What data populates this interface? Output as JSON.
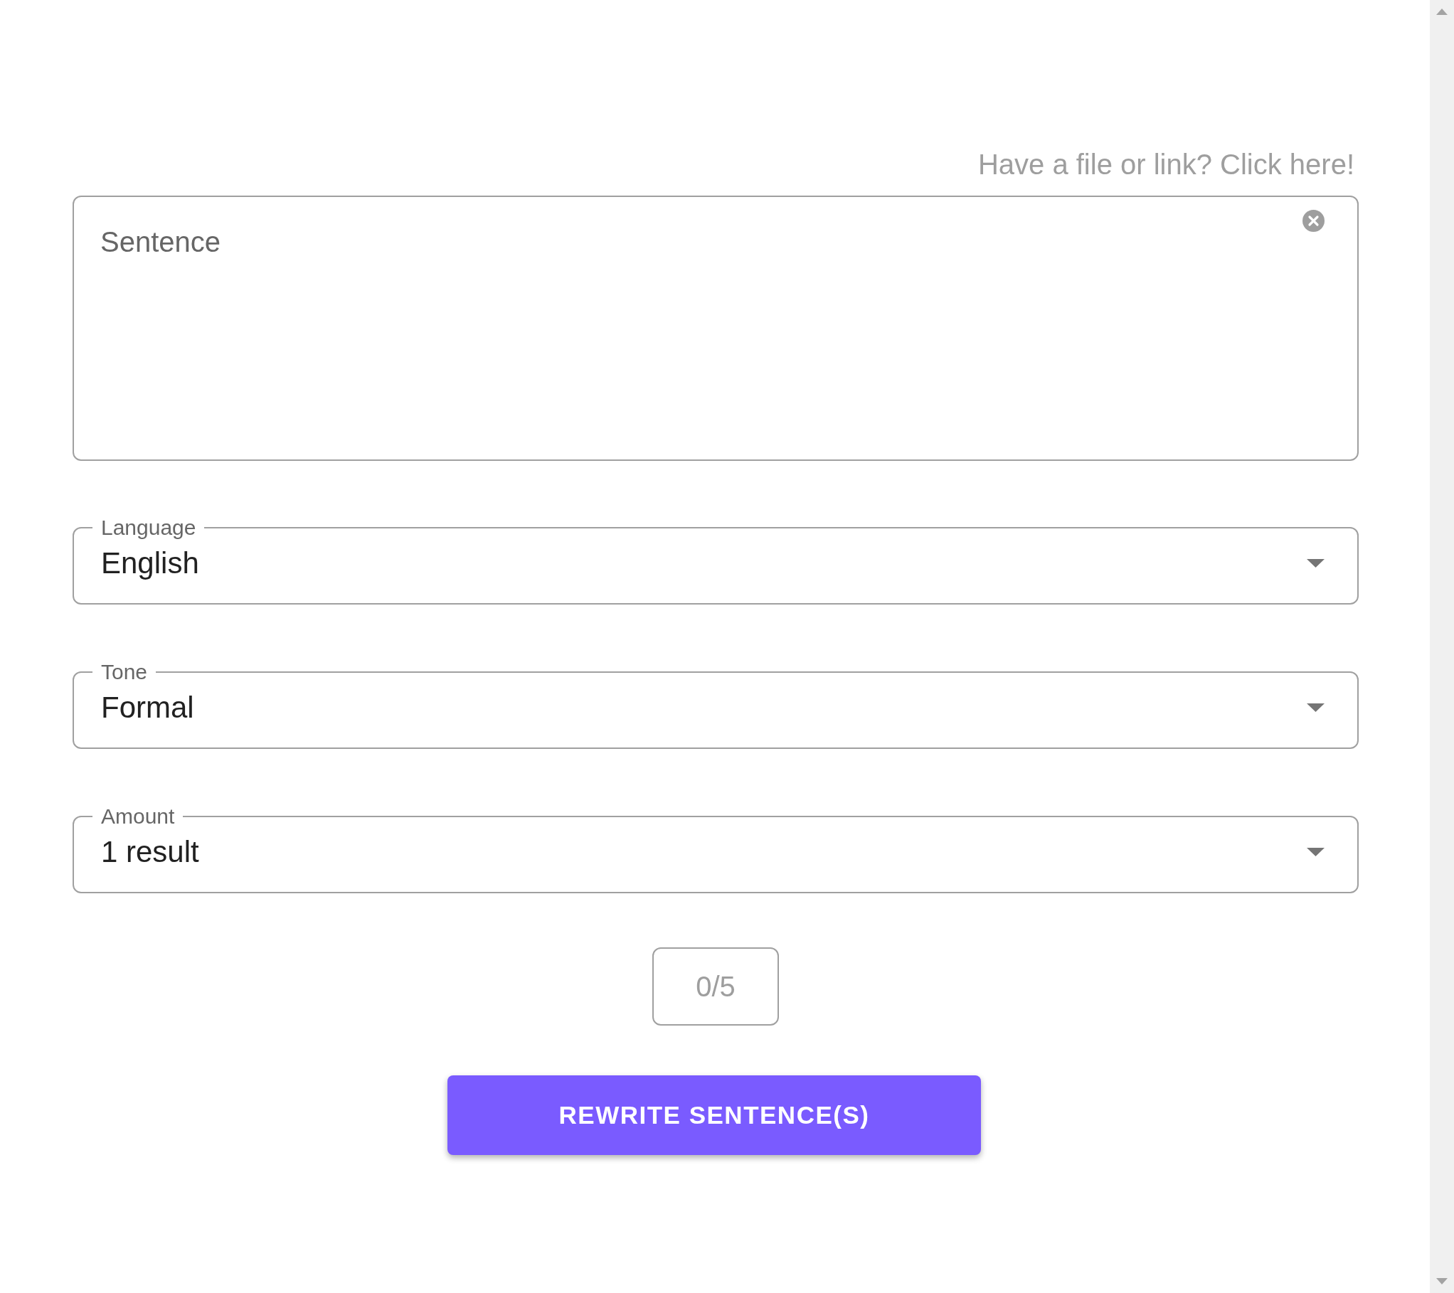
{
  "file_link": {
    "text": "Have a file or link? Click here!"
  },
  "sentence_field": {
    "placeholder": "Sentence"
  },
  "selects": [
    {
      "label": "Language",
      "value": "English"
    },
    {
      "label": "Tone",
      "value": "Formal"
    },
    {
      "label": "Amount",
      "value": "1 result"
    }
  ],
  "counter": {
    "text": "0/5"
  },
  "submit_button": {
    "label": "REWRITE SENTENCE(S)"
  }
}
